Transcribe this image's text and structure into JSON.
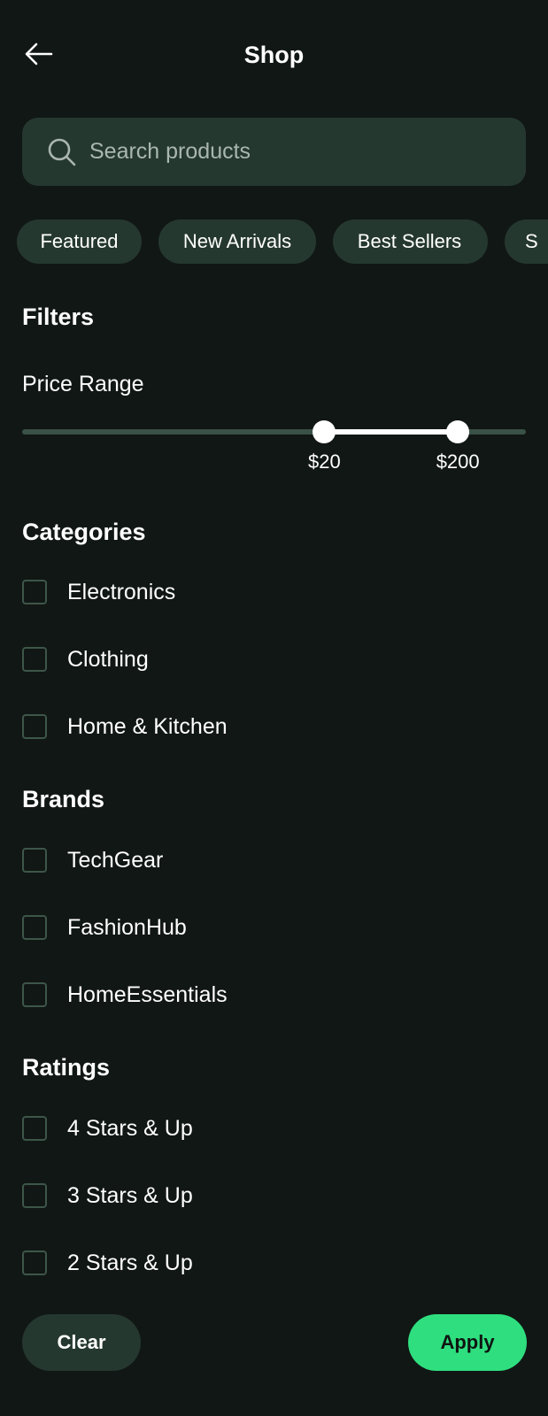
{
  "header": {
    "title": "Shop",
    "back_icon": "arrow-left-icon"
  },
  "search": {
    "placeholder": "Search products",
    "value": "",
    "icon": "search-icon"
  },
  "chips": [
    {
      "label": "Featured"
    },
    {
      "label": "New Arrivals"
    },
    {
      "label": "Best Sellers"
    },
    {
      "label": "S"
    }
  ],
  "filters": {
    "title": "Filters",
    "price": {
      "label": "Price Range",
      "min_label": "$20",
      "max_label": "$200",
      "min_fraction": 0.6,
      "max_fraction": 0.865
    }
  },
  "categories": {
    "title": "Categories",
    "items": [
      {
        "label": "Electronics",
        "checked": false
      },
      {
        "label": "Clothing",
        "checked": false
      },
      {
        "label": "Home & Kitchen",
        "checked": false
      }
    ]
  },
  "brands": {
    "title": "Brands",
    "items": [
      {
        "label": "TechGear",
        "checked": false
      },
      {
        "label": "FashionHub",
        "checked": false
      },
      {
        "label": "HomeEssentials",
        "checked": false
      }
    ]
  },
  "ratings": {
    "title": "Ratings",
    "items": [
      {
        "label": "4 Stars & Up",
        "checked": false
      },
      {
        "label": "3 Stars & Up",
        "checked": false
      },
      {
        "label": "2 Stars & Up",
        "checked": false
      }
    ]
  },
  "actions": {
    "clear_label": "Clear",
    "apply_label": "Apply"
  },
  "colors": {
    "background": "#111715",
    "surface": "#253830",
    "accent": "#2fdf7f",
    "track": "#3a5246"
  }
}
